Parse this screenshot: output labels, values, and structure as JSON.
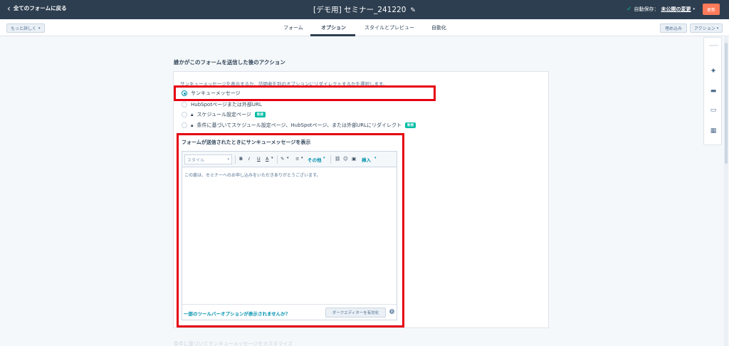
{
  "topbar": {
    "back_label": "全てのフォームに戻る",
    "title": "[デモ用] セミナー_241220",
    "autosave_prefix": "自動保存：",
    "autosave_link": "未公開の変更",
    "publish_label": "更新"
  },
  "subnav": {
    "more_label": "もっと詳しく",
    "tabs": [
      {
        "label": "フォーム"
      },
      {
        "label": "オプション"
      },
      {
        "label": "スタイルとプレビュー"
      },
      {
        "label": "自動化"
      }
    ],
    "embed_label": "埋め込み",
    "action_label": "アクション"
  },
  "main": {
    "section_heading": "誰かがこのフォームを送信した後のアクション",
    "description": "サンキューメッセージを表示するか、訪問者を別のオプションにリダイレクトするかを選択します。",
    "options": [
      {
        "label": "サンキューメッセージ",
        "checked": true
      },
      {
        "label": "HubSpotページまたは外部URL",
        "checked": false
      },
      {
        "label": "スケジュール設定ページ",
        "checked": false,
        "badge": "新規"
      },
      {
        "label": "条件に基づいてスケジュール設定ページ、HubSpotページ、または外部URLにリダイレクト",
        "checked": false,
        "badge": "新規"
      }
    ],
    "editor_heading": "フォームが送信されたときにサンキューメッセージを表示",
    "editor": {
      "style_placeholder": "スタイル",
      "bold": "B",
      "italic": "I",
      "underline": "U",
      "font_color": "A",
      "other_label": "その他",
      "insert_label": "挿入",
      "body_text": "この度は、セミナーへのお申し込みをいただきありがとうございます。",
      "footer_link": "一部のツールバーオプションが表示されませんか？",
      "dark_editor_label": "ダークエディターを有効化"
    },
    "faded_text": "条件に基づいてサンキューメッセージをカスタマイズ"
  },
  "colors": {
    "topbar_bg": "#2d3e50",
    "accent": "#0091ae",
    "publish": "#ff7a59",
    "badge": "#00bda5",
    "highlight": "#e60012"
  },
  "rail_icons": [
    "grid-icon",
    "sparkle-icon",
    "chat-icon",
    "window-icon",
    "calendar-icon"
  ]
}
